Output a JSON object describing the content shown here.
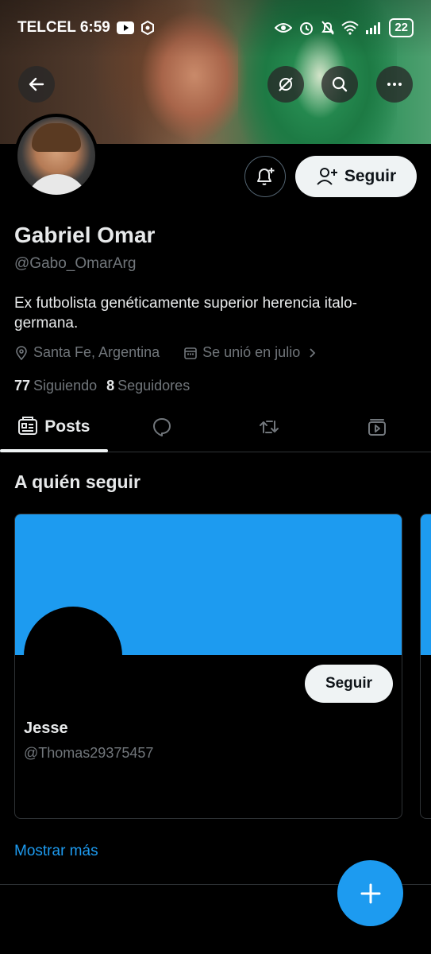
{
  "status_bar": {
    "carrier_time": "TELCEL 6:59",
    "battery": "22"
  },
  "profile": {
    "name": "Gabriel Omar",
    "handle": "@Gabo_OmarArg",
    "bio": "Ex futbolista genéticamente superior herencia italo-germana.",
    "location": "Santa Fe, Argentina",
    "joined": "Se unió en julio",
    "following_count": "77",
    "following_label": "Siguiendo",
    "followers_count": "8",
    "followers_label": "Seguidores",
    "follow_label": "Seguir"
  },
  "tabs": [
    {
      "label": "Posts",
      "icon": "posts-icon",
      "active": true
    },
    {
      "label": "",
      "icon": "reply-icon"
    },
    {
      "label": "",
      "icon": "repost-icon"
    },
    {
      "label": "",
      "icon": "media-icon"
    }
  ],
  "who_to_follow": {
    "title": "A quién seguir",
    "cards": [
      {
        "name": "Jesse",
        "handle": "@Thomas29375457",
        "follow_label": "Seguir"
      }
    ],
    "show_more": "Mostrar más"
  },
  "colors": {
    "accent": "#1d9bf0",
    "background": "#000000",
    "text_primary": "#e7e9ea",
    "text_secondary": "#71767b"
  }
}
